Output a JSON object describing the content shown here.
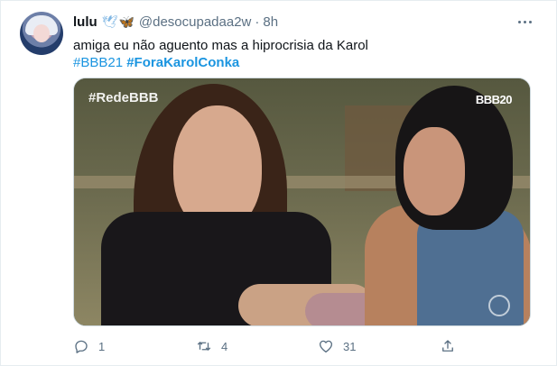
{
  "tweet": {
    "display_name": "lulu",
    "name_emoji": "🕊🦋",
    "handle": "@desocupadaa2w",
    "separator": "·",
    "time": "8h",
    "text": "amiga eu não aguento mas a hiprocrisia da Karol",
    "hashtags": [
      "#BBB21",
      "#ForaKarolConka"
    ]
  },
  "media": {
    "watermark_left": "#RedeBBB",
    "watermark_right": "BBB20"
  },
  "actions": {
    "reply_count": "1",
    "retweet_count": "4",
    "like_count": "31"
  },
  "colors": {
    "link": "#1b95e0",
    "secondary_text": "#5b7083",
    "border": "#e6ecf0"
  },
  "icons": [
    "avatar",
    "more-icon",
    "reply-icon",
    "retweet-icon",
    "like-icon",
    "share-icon"
  ]
}
